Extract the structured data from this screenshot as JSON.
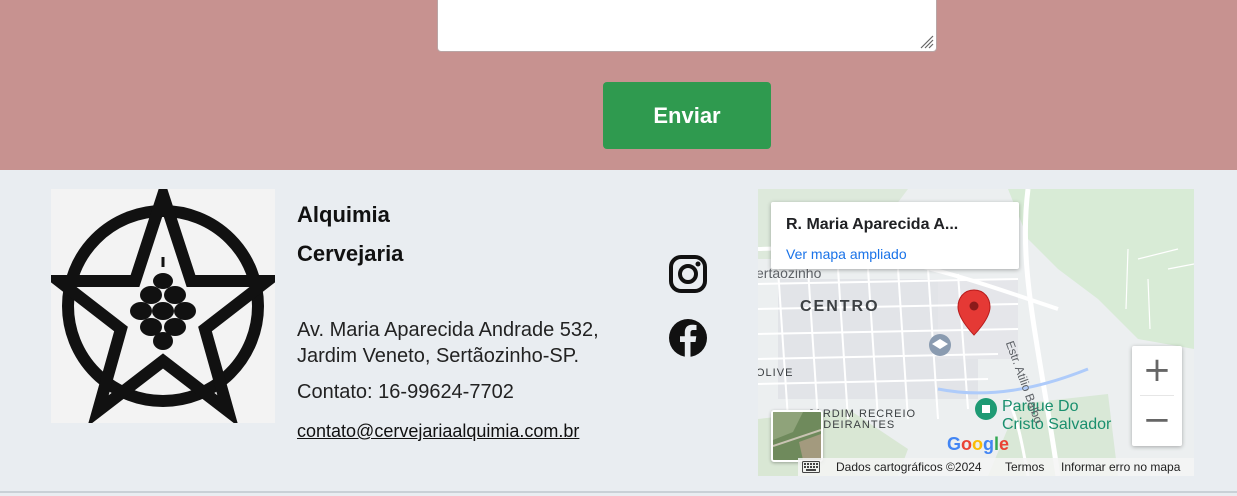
{
  "form": {
    "submit_label": "Enviar"
  },
  "footer": {
    "brand_line1": "Alquimia",
    "brand_line2": "Cervejaria",
    "address_line1": "Av. Maria Aparecida Andrade 532,",
    "address_line2": "Jardim Veneto, Sertãozinho-SP.",
    "contact": "Contato: 16-99624-7702",
    "email": "contato@cervejariaalquimia.com.br",
    "social": [
      "instagram-icon",
      "facebook-icon"
    ]
  },
  "map": {
    "card_title": "R. Maria Aparecida A...",
    "card_link": "Ver mapa ampliado",
    "labels": {
      "city": "ertaozinho",
      "centro": "CENTRO",
      "olive": "OLIVE",
      "recreio": "JARDIM RECREIO",
      "bandeirantes": "ANDEIRANTES",
      "park_line1": "Parque Do",
      "park_line2": "Cristo Salvador",
      "road": "Estr. Atilio Balbo"
    },
    "zoom_in": "+",
    "zoom_out": "−",
    "attribution": {
      "data": "Dados cartográficos ©2024",
      "terms": "Termos",
      "report": "Informar erro no mapa"
    },
    "colors": {
      "marker": "#e53935",
      "park": "#1a8f6e",
      "link": "#1a73e8"
    }
  },
  "colors": {
    "form_bg": "#c79290",
    "footer_bg": "#e9edf1",
    "button_bg": "#2f9a4f"
  }
}
